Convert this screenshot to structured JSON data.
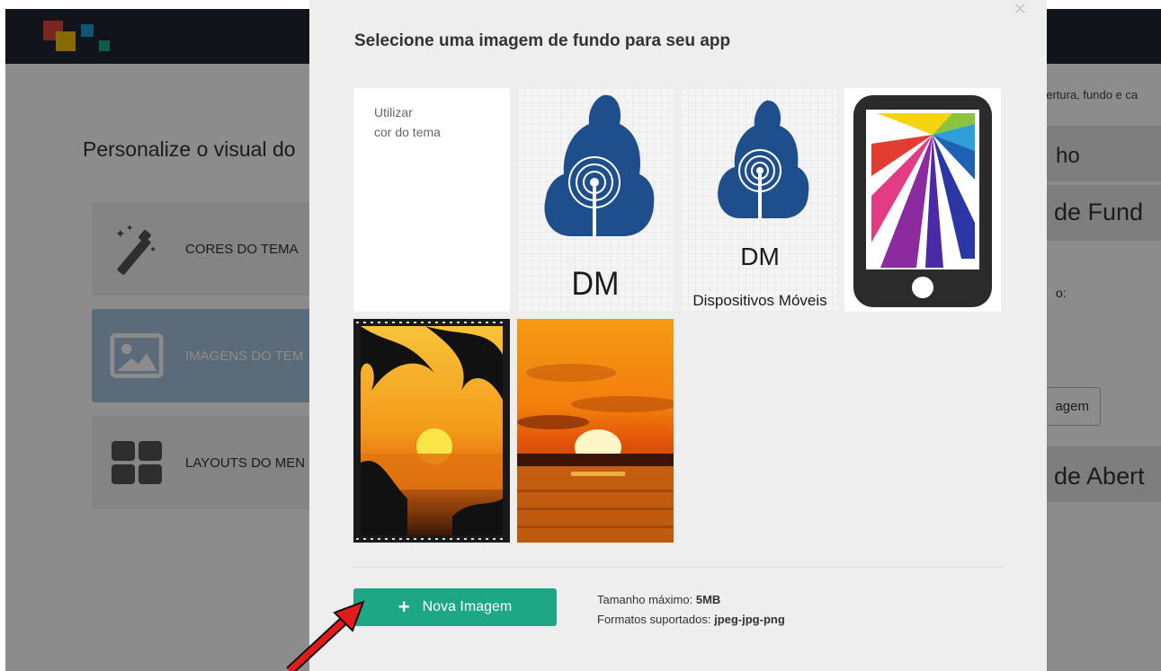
{
  "background": {
    "breadcrumb_fragment": "bertura, fundo e ca",
    "page_title": "Personalize o visual do",
    "side_items": [
      {
        "label": "CORES DO TEMA",
        "icon": "magic-wand-icon",
        "active": false
      },
      {
        "label": "IMAGENS DO TEM",
        "icon": "image-icon",
        "active": true
      },
      {
        "label": "LAYOUTS DO MEN",
        "icon": "grid-layout-icon",
        "active": false
      }
    ],
    "right_heading_1": "ho",
    "right_heading_2": "de Fund",
    "right_label": "o:",
    "right_button": "agem",
    "right_heading_3": "de Abert"
  },
  "modal": {
    "close_icon": "close-icon",
    "title": "Selecione uma imagem de fundo para seu app",
    "color_tile": {
      "line1": "Utilizar",
      "line2": "cor do tema"
    },
    "images": [
      {
        "name": "dm-logo",
        "caption": "DM"
      },
      {
        "name": "dm-dispositivos-moveis-logo",
        "caption_top": "DM",
        "caption_bottom": "Dispositivos Móveis"
      },
      {
        "name": "phone-colorful-logo"
      },
      {
        "name": "palm-sunset-film"
      },
      {
        "name": "sea-sunset"
      }
    ],
    "new_button": {
      "icon": "plus-icon",
      "label": "Nova Imagem"
    },
    "max_size_label": "Tamanho máximo:",
    "max_size_value": "5MB",
    "formats_label": "Formatos suportados:",
    "formats_value": "jpeg-jpg-png"
  },
  "colors": {
    "topbar": "#1f2532",
    "accent_green": "#1ea784",
    "active_card": "#a8c3dd",
    "annotation_arrow": "#e51b1b"
  }
}
